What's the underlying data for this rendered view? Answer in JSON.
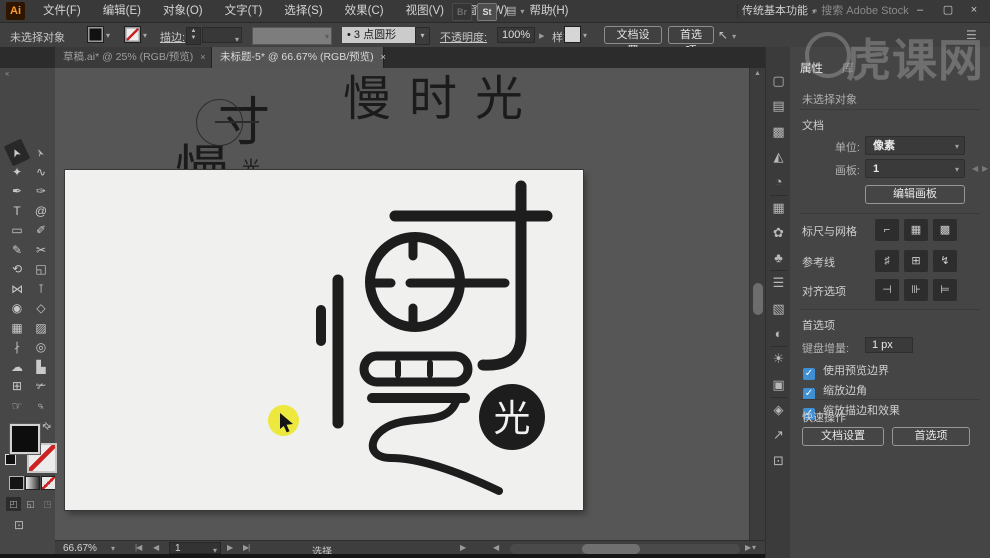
{
  "menu": {
    "logo": "Ai",
    "items": [
      "文件(F)",
      "编辑(E)",
      "对象(O)",
      "文字(T)",
      "选择(S)",
      "效果(C)",
      "视图(V)",
      "窗口(W)",
      "帮助(H)"
    ],
    "bridge_label": "Br",
    "stock_label": "St",
    "arrange_glyph": "▤",
    "share_glyph": "⌁",
    "workspace_label": "传统基本功能",
    "search_icon": "⌕",
    "search_placeholder": "搜索 Adobe Stock",
    "win": {
      "min": "–",
      "max": "▢",
      "close": "×"
    }
  },
  "options": {
    "no_selection": "未选择对象",
    "stroke_label": "描边:",
    "brush_preset": "•  3 点圆形",
    "opacity_label": "不透明度:",
    "opacity_value": "100%",
    "opacity_more": "▸",
    "style_label": "样式:",
    "doc_setup_btn": "文档设置",
    "preferences_btn": "首选项",
    "cursor_glyph": "↖",
    "panel_menu_glyph": "☰"
  },
  "tabs": {
    "tab1": "草稿.ai* @ 25% (RGB/预览)",
    "tab2": "未标题-5* @ 66.67% (RGB/预览)",
    "close_glyph": "×"
  },
  "toolbar": {
    "collapse_glyph": "‹‹",
    "tools": [
      {
        "glyph": "➤",
        "name": "selection-tool"
      },
      {
        "glyph": "➢",
        "name": "direct-selection-tool"
      },
      {
        "glyph": "✦",
        "name": "magic-wand-tool"
      },
      {
        "glyph": "∿",
        "name": "lasso-tool"
      },
      {
        "glyph": "✒",
        "name": "pen-tool"
      },
      {
        "glyph": "✑",
        "name": "curvature-tool"
      },
      {
        "glyph": "T",
        "name": "type-tool"
      },
      {
        "glyph": "@",
        "name": "line-segment-tool"
      },
      {
        "glyph": "▭",
        "name": "rectangle-tool"
      },
      {
        "glyph": "✐",
        "name": "paintbrush-tool"
      },
      {
        "glyph": "✎",
        "name": "shaper-tool"
      },
      {
        "glyph": "✂",
        "name": "scissors-tool"
      },
      {
        "glyph": "⟲",
        "name": "rotate-tool"
      },
      {
        "glyph": "◱",
        "name": "free-transform-tool"
      },
      {
        "glyph": "⋈",
        "name": "width-tool"
      },
      {
        "glyph": "⊺",
        "name": "puppet-warp-tool"
      },
      {
        "glyph": "◉",
        "name": "shape-builder-tool"
      },
      {
        "glyph": "◇",
        "name": "perspective-grid-tool"
      },
      {
        "glyph": "▦",
        "name": "mesh-tool"
      },
      {
        "glyph": "▨",
        "name": "gradient-tool"
      },
      {
        "glyph": "∤",
        "name": "eyedropper-tool"
      },
      {
        "glyph": "◎",
        "name": "blend-tool"
      },
      {
        "glyph": "☁",
        "name": "symbol-sprayer-tool"
      },
      {
        "glyph": "▙",
        "name": "column-graph-tool"
      },
      {
        "glyph": "⊞",
        "name": "artboard-tool"
      },
      {
        "glyph": "✃",
        "name": "slice-tool"
      },
      {
        "glyph": "☞",
        "name": "hand-tool"
      },
      {
        "glyph": "♀",
        "name": "zoom-tool"
      }
    ]
  },
  "canvas": {
    "reference_text": "慢时光",
    "draft": {
      "man": "慢",
      "cun": "寸",
      "guang": "光"
    },
    "logo_badge_char": "光"
  },
  "status": {
    "zoom_level": "66.67%",
    "artboard_number": "1",
    "active_tool": "选择",
    "nav": [
      {
        "glyph": "|◀",
        "name": "first-artboard-button"
      },
      {
        "glyph": "◀",
        "name": "prev-artboard-button"
      },
      {
        "glyph": "▶",
        "name": "next-artboard-button"
      },
      {
        "glyph": "▶|",
        "name": "last-artboard-button"
      }
    ]
  },
  "panelstrip": {
    "icons": [
      {
        "glyph": "▢",
        "name": "artboards-panel-icon"
      },
      {
        "glyph": "▤",
        "name": "align-panel-icon"
      },
      {
        "glyph": "▩",
        "name": "pathfinder-panel-icon"
      },
      {
        "glyph": "◭",
        "name": "color-panel-icon"
      },
      {
        "glyph": "◔",
        "name": "color-guide-panel-icon"
      },
      {
        "glyph": "▦",
        "name": "swatches-panel-icon"
      },
      {
        "glyph": "✿",
        "name": "brushes-panel-icon"
      },
      {
        "glyph": "♣",
        "name": "symbols-panel-icon"
      },
      {
        "glyph": "☰",
        "name": "stroke-panel-icon"
      },
      {
        "glyph": "▧",
        "name": "gradient-panel-icon"
      },
      {
        "glyph": "◐",
        "name": "transparency-panel-icon"
      },
      {
        "glyph": "☀",
        "name": "appearance-panel-icon"
      },
      {
        "glyph": "▣",
        "name": "graphic-styles-panel-icon"
      },
      {
        "glyph": "◈",
        "name": "layers-panel-icon"
      },
      {
        "glyph": "↗",
        "name": "export-panel-icon"
      },
      {
        "glyph": "⊡",
        "name": "artboard-panel-icon"
      }
    ]
  },
  "panel": {
    "tab_properties": "属性",
    "tab_libraries": "库",
    "no_selection": "未选择对象",
    "doc_section": "文档",
    "unit_label": "单位:",
    "unit_value": "像素",
    "artboard_label": "画板:",
    "artboard_value": "1",
    "edit_artboard_btn": "编辑画板",
    "ruler_section": "标尺与网格",
    "guides_section": "参考线",
    "snap_section": "对齐选项",
    "pref_section": "首选项",
    "keyboard_label": "键盘增量:",
    "keyboard_value": "1 px",
    "ruler_icons": [
      {
        "glyph": "⌐",
        "name": "ruler-icon"
      },
      {
        "glyph": "▦",
        "name": "grid-icon"
      },
      {
        "glyph": "▩",
        "name": "transparency-grid-icon"
      }
    ],
    "guides_icons": [
      {
        "glyph": "♯",
        "name": "guides-icon"
      },
      {
        "glyph": "⊞",
        "name": "lock-guides-icon"
      },
      {
        "glyph": "↯",
        "name": "smart-guides-icon"
      }
    ],
    "snap_icons": [
      {
        "glyph": "⊣",
        "name": "snap-grid-icon"
      },
      {
        "glyph": "⊪",
        "name": "snap-pixel-icon"
      },
      {
        "glyph": "⊨",
        "name": "snap-point-icon"
      }
    ],
    "checkboxes": [
      "使用预览边界",
      "缩放边角",
      "缩放描边和效果"
    ],
    "quick_section": "快速操作",
    "doc_setup_btn": "文档设置",
    "preferences_btn": "首选项"
  },
  "watermark": {
    "text": "虎课网"
  },
  "colors": {
    "accent_blue": "#3f8fd5",
    "highlight_yellow": "#ece83d",
    "artboard_bg": "#f0f0ee",
    "canvas_bg": "#565656",
    "panel_bg": "#454545",
    "stroke_none_red": "#cc2222",
    "artwork_black": "#1d1d1d"
  }
}
